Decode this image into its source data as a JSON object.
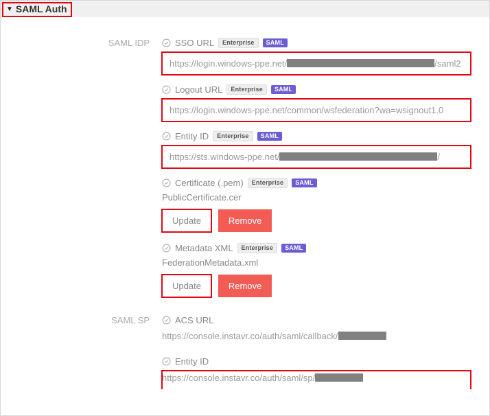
{
  "header": {
    "title": "SAML Auth"
  },
  "idp": {
    "section_label": "SAML IDP",
    "sso_url": {
      "label": "SSO URL",
      "badge_ent": "Enterprise",
      "badge_saml": "SAML",
      "prefix": "https://login.windows-ppe.net/",
      "suffix": "/saml2"
    },
    "logout_url": {
      "label": "Logout URL",
      "badge_ent": "Enterprise",
      "badge_saml": "SAML",
      "value": "https://login.windows-ppe.net/common/wsfederation?wa=wsignout1.0"
    },
    "entity_id": {
      "label": "Entity ID",
      "badge_ent": "Enterprise",
      "badge_saml": "SAML",
      "prefix": "https://sts.windows-ppe.net/",
      "suffix": "/"
    },
    "certificate": {
      "label": "Certificate (.pem)",
      "badge_ent": "Enterprise",
      "badge_saml": "SAML",
      "filename": "PublicCertificate.cer",
      "update": "Update",
      "remove": "Remove"
    },
    "metadata": {
      "label": "Metadata XML",
      "badge_ent": "Enterprise",
      "badge_saml": "SAML",
      "filename": "FederationMetadata.xml",
      "update": "Update",
      "remove": "Remove"
    }
  },
  "sp": {
    "section_label": "SAML SP",
    "acs_url": {
      "label": "ACS URL",
      "prefix": "https://console.instavr.co/auth/saml/callback/"
    },
    "entity_id": {
      "label": "Entity ID",
      "prefix": "https://console.instavr.co/auth/saml/sp/"
    }
  }
}
